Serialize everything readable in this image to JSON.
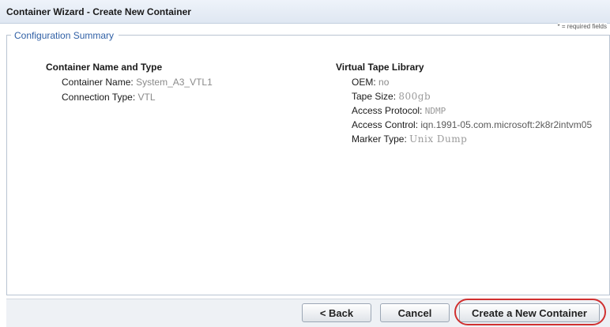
{
  "window": {
    "title": "Container Wizard - Create New Container"
  },
  "panel": {
    "legend": "Configuration Summary",
    "required_note": "* = required fields"
  },
  "container_section": {
    "heading": "Container Name and Type",
    "fields": [
      {
        "label": "Container Name:",
        "value": "System_A3_VTL1"
      },
      {
        "label": "Connection Type:",
        "value": "VTL"
      }
    ]
  },
  "vtl_section": {
    "heading": "Virtual Tape Library",
    "fields": [
      {
        "label": "OEM:",
        "value": "no"
      },
      {
        "label": "Tape Size:",
        "value": "800gb"
      },
      {
        "label": "Access Protocol:",
        "value": "NDMP"
      },
      {
        "label": "Access Control:",
        "value": "iqn.1991-05.com.microsoft:2k8r2intvm05"
      },
      {
        "label": "Marker Type:",
        "value": "Unix Dump"
      }
    ]
  },
  "footer": {
    "back_label": "< Back",
    "cancel_label": "Cancel",
    "create_label": "Create a New Container"
  },
  "colors": {
    "legend": "#2f5fa5",
    "highlight_ring": "#d03030"
  }
}
